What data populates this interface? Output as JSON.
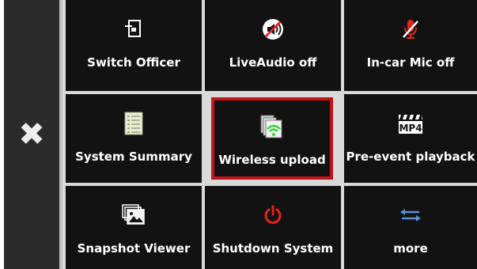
{
  "close_button": {
    "icon": "close-x-icon",
    "glyph": "✖"
  },
  "tiles": [
    {
      "label": "Switch Officer",
      "icon": "switch-officer-icon"
    },
    {
      "label": "LiveAudio off",
      "icon": "speaker-muted-icon"
    },
    {
      "label": "In-car Mic off",
      "icon": "mic-muted-icon"
    },
    {
      "label": "System Summary",
      "icon": "checklist-icon"
    },
    {
      "label": "Wireless upload",
      "icon": "wireless-upload-icon",
      "selected": true
    },
    {
      "label": "Pre-event playback",
      "icon": "mp4-clapper-icon"
    },
    {
      "label": "Snapshot Viewer",
      "icon": "snapshot-gallery-icon"
    },
    {
      "label": "Shutdown System",
      "icon": "power-icon"
    },
    {
      "label": "more",
      "icon": "swap-arrows-icon"
    }
  ],
  "mp4_text": "MP4",
  "colors": {
    "tile_bg": "#121212",
    "selected_border": "#c0141b",
    "grid_line": "#d9d9d9",
    "power_red": "#e5231b",
    "wifi_green": "#39d53a",
    "arrows_blue": "#5b8fd6"
  }
}
